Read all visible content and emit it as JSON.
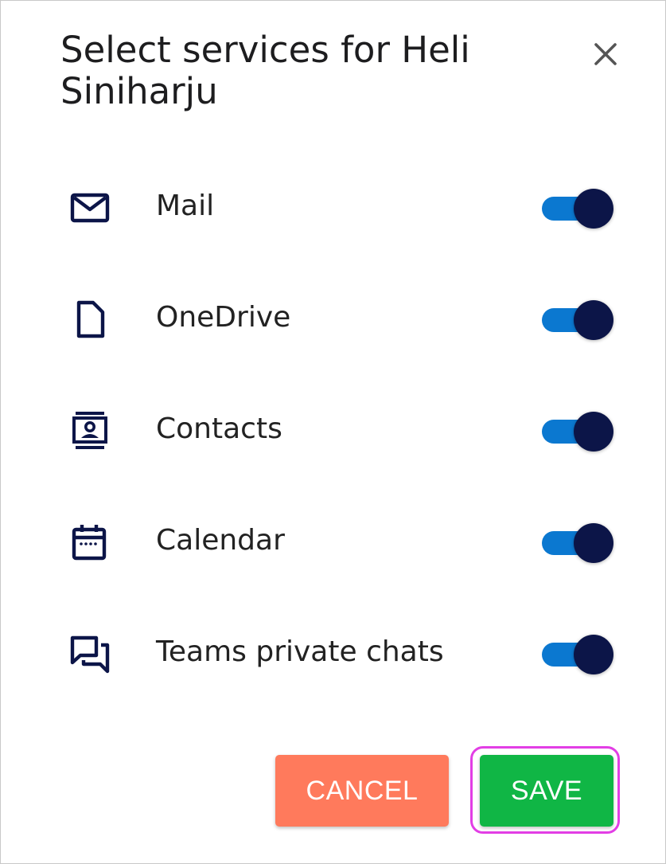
{
  "dialog": {
    "title": "Select services for Heli Siniharju",
    "close_icon": "close-icon"
  },
  "services": [
    {
      "icon": "mail-icon",
      "label": "Mail",
      "enabled": true
    },
    {
      "icon": "document-icon",
      "label": "OneDrive",
      "enabled": true
    },
    {
      "icon": "contact-card-icon",
      "label": "Contacts",
      "enabled": true
    },
    {
      "icon": "calendar-icon",
      "label": "Calendar",
      "enabled": true
    },
    {
      "icon": "chat-icon",
      "label": "Teams private chats",
      "enabled": true
    }
  ],
  "actions": {
    "cancel_label": "CANCEL",
    "save_label": "SAVE"
  },
  "colors": {
    "toggle_track_on": "#0b78d0",
    "toggle_knob": "#0c1548",
    "icon": "#0c1548",
    "cancel_button": "#ff7a5c",
    "save_button": "#10b645",
    "focus_ring": "#e23ee5"
  }
}
